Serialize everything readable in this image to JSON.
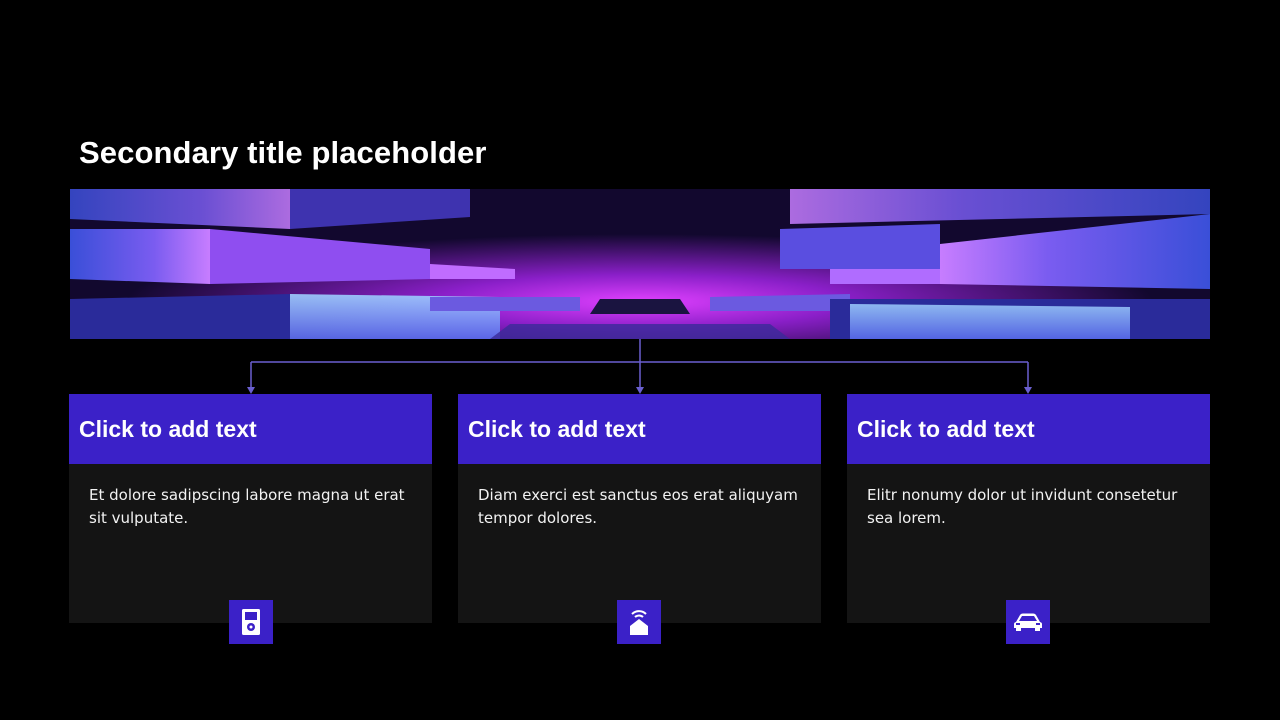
{
  "slide": {
    "title": "Secondary title placeholder"
  },
  "banner": {
    "image": "abstract-purple-neon-blocks"
  },
  "colors": {
    "background": "#000000",
    "accent": "#3b21c8",
    "card_body": "#141414",
    "connector": "#6a5fd0"
  },
  "cards": [
    {
      "title": "Click to add text",
      "body": "Et dolore sadipscing labore magna ut erat sit vulputate.",
      "icon": "media-player-icon"
    },
    {
      "title": "Click to add text",
      "body": "Diam exerci est sanctus eos erat aliquyam tempor dolores.",
      "icon": "smart-home-icon"
    },
    {
      "title": "Click to add text",
      "body": "Elitr nonumy dolor ut invidunt consetetur sea lorem.",
      "icon": "car-icon"
    }
  ]
}
